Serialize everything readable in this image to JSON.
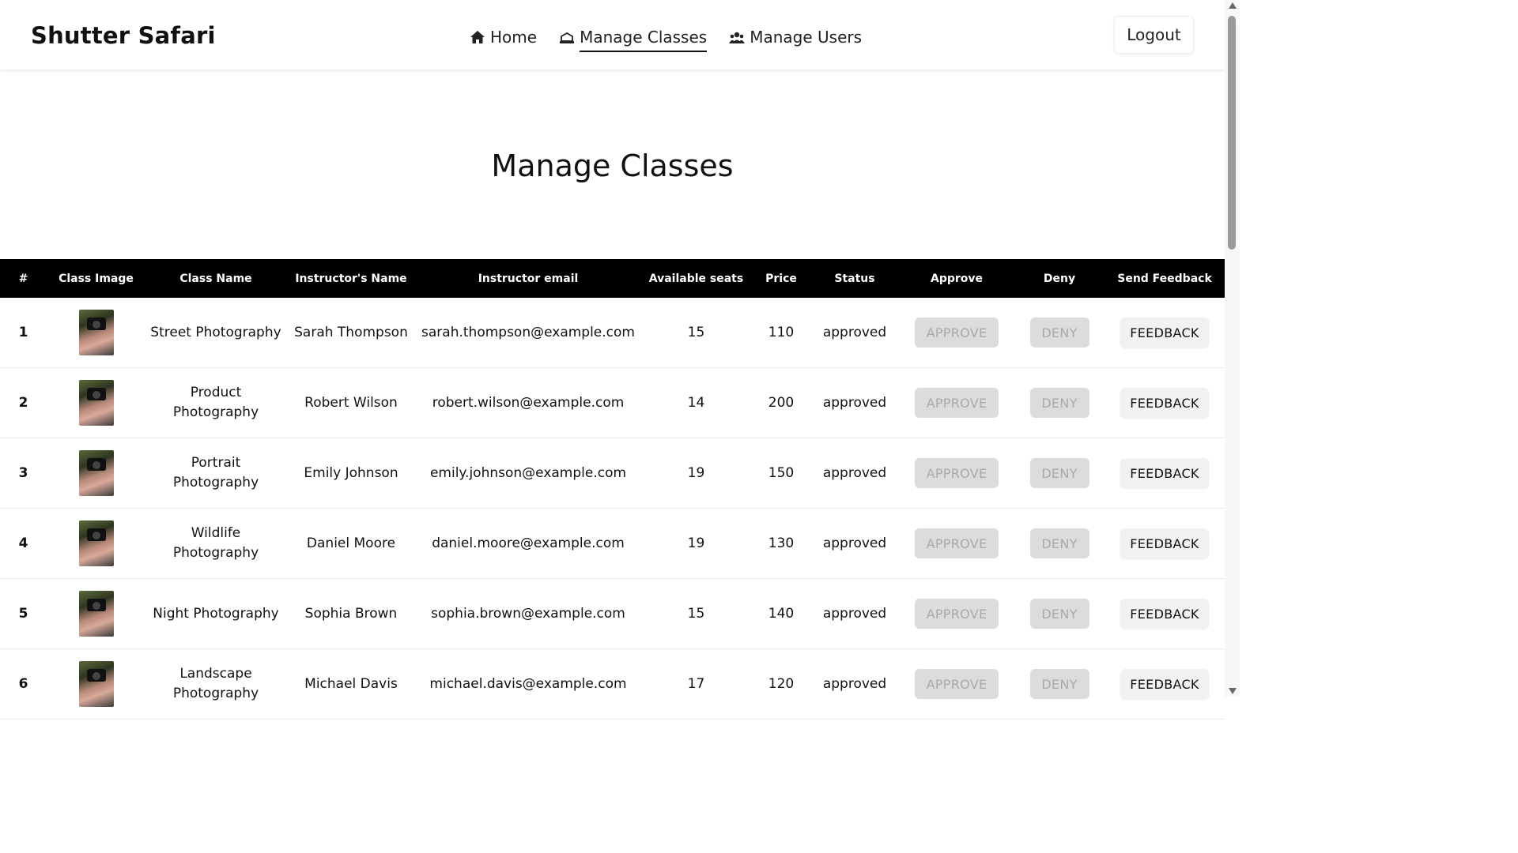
{
  "brand": "Shutter Safari",
  "nav": {
    "items": [
      {
        "label": "Home",
        "icon": "home-icon"
      },
      {
        "label": "Manage Classes",
        "icon": "classroom-icon"
      },
      {
        "label": "Manage Users",
        "icon": "users-icon"
      }
    ],
    "logout": "Logout"
  },
  "page_title": "Manage Classes",
  "table": {
    "headers": [
      "#",
      "Class Image",
      "Class Name",
      "Instructor's Name",
      "Instructor email",
      "Available seats",
      "Price",
      "Status",
      "Approve",
      "Deny",
      "Send Feedback"
    ],
    "rows": [
      {
        "idx": "1",
        "class_name": "Street Photography",
        "instructor": "Sarah Thompson",
        "email": "sarah.thompson@example.com",
        "seats": "15",
        "price": "110",
        "status": "approved"
      },
      {
        "idx": "2",
        "class_name": "Product Photography",
        "instructor": "Robert Wilson",
        "email": "robert.wilson@example.com",
        "seats": "14",
        "price": "200",
        "status": "approved"
      },
      {
        "idx": "3",
        "class_name": "Portrait Photography",
        "instructor": "Emily Johnson",
        "email": "emily.johnson@example.com",
        "seats": "19",
        "price": "150",
        "status": "approved"
      },
      {
        "idx": "4",
        "class_name": "Wildlife Photography",
        "instructor": "Daniel Moore",
        "email": "daniel.moore@example.com",
        "seats": "19",
        "price": "130",
        "status": "approved"
      },
      {
        "idx": "5",
        "class_name": "Night Photography",
        "instructor": "Sophia Brown",
        "email": "sophia.brown@example.com",
        "seats": "15",
        "price": "140",
        "status": "approved"
      },
      {
        "idx": "6",
        "class_name": "Landscape Photography",
        "instructor": "Michael Davis",
        "email": "michael.davis@example.com",
        "seats": "17",
        "price": "120",
        "status": "approved"
      }
    ],
    "buttons": {
      "approve": "APPROVE",
      "deny": "DENY",
      "feedback": "FEEDBACK"
    }
  }
}
